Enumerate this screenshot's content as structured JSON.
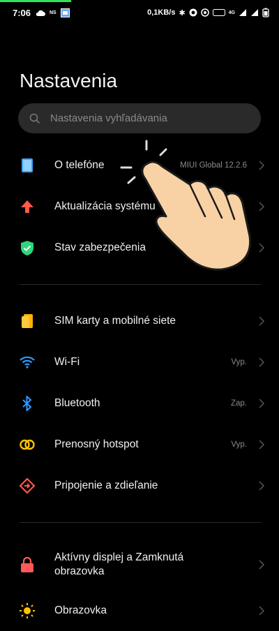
{
  "status_bar": {
    "time": "7:06",
    "ns": "NS",
    "net_speed": "0,1KB/s",
    "lte": "4G",
    "accent_color": "#2fe35a"
  },
  "header": {
    "title": "Nastavenia"
  },
  "search": {
    "placeholder": "Nastavenia vyhľadávania"
  },
  "groups": [
    {
      "items": [
        {
          "label": "O telefóne",
          "value": "MIUI Global 12.2.6",
          "icon": "phone-icon"
        },
        {
          "label": "Aktualizácia systému",
          "value": "",
          "icon": "update-arrow-icon"
        },
        {
          "label": "Stav zabezpečenia",
          "value": "",
          "icon": "shield-check-icon"
        }
      ]
    },
    {
      "items": [
        {
          "label": "SIM karty a mobilné siete",
          "value": "",
          "icon": "sim-icon"
        },
        {
          "label": "Wi-Fi",
          "value": "Vyp.",
          "icon": "wifi-icon"
        },
        {
          "label": "Bluetooth",
          "value": "Zap.",
          "icon": "bluetooth-icon"
        },
        {
          "label": "Prenosný hotspot",
          "value": "Vyp.",
          "icon": "hotspot-icon"
        },
        {
          "label": "Pripojenie a zdieľanie",
          "value": "",
          "icon": "share-icon"
        }
      ]
    },
    {
      "items": [
        {
          "label": "Aktívny displej a Zamknutá obrazovka",
          "value": "",
          "icon": "lock-icon"
        },
        {
          "label": "Obrazovka",
          "value": "",
          "icon": "sun-icon"
        }
      ]
    }
  ]
}
